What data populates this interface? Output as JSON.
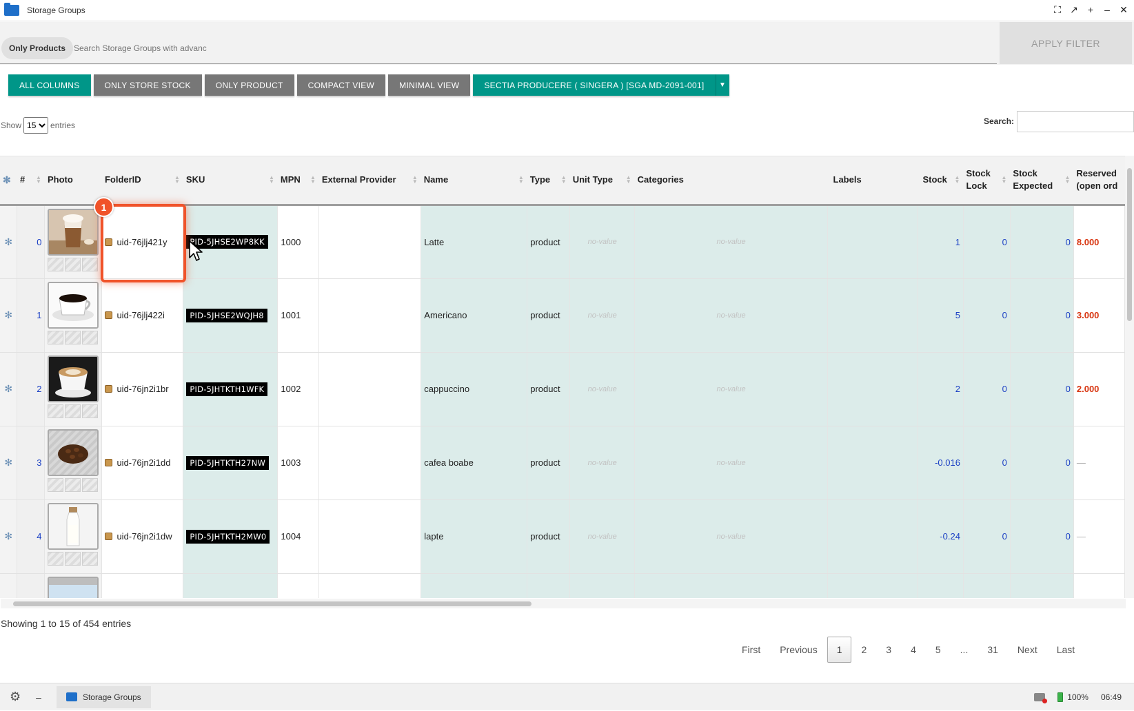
{
  "window": {
    "title": "Storage Groups",
    "controls": [
      "⛶",
      "↗",
      "+",
      "–",
      "✕"
    ]
  },
  "filter": {
    "chip": "Only Products",
    "placeholder": "Search Storage Groups with advanc",
    "apply": "APPLY FILTER"
  },
  "view_buttons": {
    "all_columns": "ALL COLUMNS",
    "only_store_stock": "ONLY STORE STOCK",
    "only_product": "ONLY PRODUCT",
    "compact_view": "COMPACT VIEW",
    "minimal_view": "MINIMAL VIEW",
    "store_selector": "SECTIA PRODUCERE ( SINGERA ) [SGA MD-2091-001]"
  },
  "entries": {
    "show": "Show",
    "value": "15",
    "suffix": "entries"
  },
  "search": {
    "label": "Search:"
  },
  "columns": {
    "idx": "#",
    "photo": "Photo",
    "folder": "FolderID",
    "sku": "SKU",
    "mpn": "MPN",
    "provider": "External Provider",
    "name": "Name",
    "type": "Type",
    "unit": "Unit Type",
    "categories": "Categories",
    "labels": "Labels",
    "stock": "Stock",
    "stock_lock_1": "Stock",
    "stock_lock_2": "Lock",
    "stock_exp_1": "Stock",
    "stock_exp_2": "Expected",
    "reserved_1": "Reserved",
    "reserved_2": "(open ord"
  },
  "rows": [
    {
      "idx": "0",
      "photo": "latte-glass-photo",
      "folder": "uid-76jlj421y",
      "sku": "PID-5JHSE2WP8KK",
      "mpn": "1000",
      "name": "Latte",
      "type": "product",
      "unit": "no-value",
      "categories": "no-value",
      "stock": "1",
      "lock": "0",
      "expected": "0",
      "reserved": "8.000"
    },
    {
      "idx": "1",
      "photo": "americano-cup-photo",
      "folder": "uid-76jlj422i",
      "sku": "PID-5JHSE2WQJH8",
      "mpn": "1001",
      "name": "Americano",
      "type": "product",
      "unit": "no-value",
      "categories": "no-value",
      "stock": "5",
      "lock": "0",
      "expected": "0",
      "reserved": "3.000"
    },
    {
      "idx": "2",
      "photo": "cappuccino-cup-photo",
      "folder": "uid-76jn2i1br",
      "sku": "PID-5JHTKTH1WFK",
      "mpn": "1002",
      "name": "cappuccino",
      "type": "product",
      "unit": "no-value",
      "categories": "no-value",
      "stock": "2",
      "lock": "0",
      "expected": "0",
      "reserved": "2.000"
    },
    {
      "idx": "3",
      "photo": "coffee-beans-photo",
      "folder": "uid-76jn2i1dd",
      "sku": "PID-5JHTKTH27NW",
      "mpn": "1003",
      "name": "cafea boabe",
      "type": "product",
      "unit": "no-value",
      "categories": "no-value",
      "stock": "-0.016",
      "lock": "0",
      "expected": "0",
      "reserved": "—"
    },
    {
      "idx": "4",
      "photo": "milk-bottle-photo",
      "folder": "uid-76jn2i1dw",
      "sku": "PID-5JHTKTH2MW0",
      "mpn": "1004",
      "name": "lapte",
      "type": "product",
      "unit": "no-value",
      "categories": "no-value",
      "stock": "-0.24",
      "lock": "0",
      "expected": "0",
      "reserved": "—"
    }
  ],
  "highlight": {
    "badge": "1"
  },
  "footer": {
    "info": "Showing 1 to 15 of 454 entries"
  },
  "pager": {
    "first": "First",
    "previous": "Previous",
    "p1": "1",
    "p2": "2",
    "p3": "3",
    "p4": "4",
    "p5": "5",
    "ellipsis": "...",
    "p31": "31",
    "next": "Next",
    "last": "Last"
  },
  "taskbar": {
    "app": "Storage Groups",
    "battery": "100%",
    "time": "06:49"
  },
  "colors": {
    "accent": "#009688",
    "grey_button": "#777777",
    "highlight": "#f0532a",
    "reserved": "#d8340f",
    "link_number": "#1a3fc4",
    "tint": "#dcecea"
  }
}
